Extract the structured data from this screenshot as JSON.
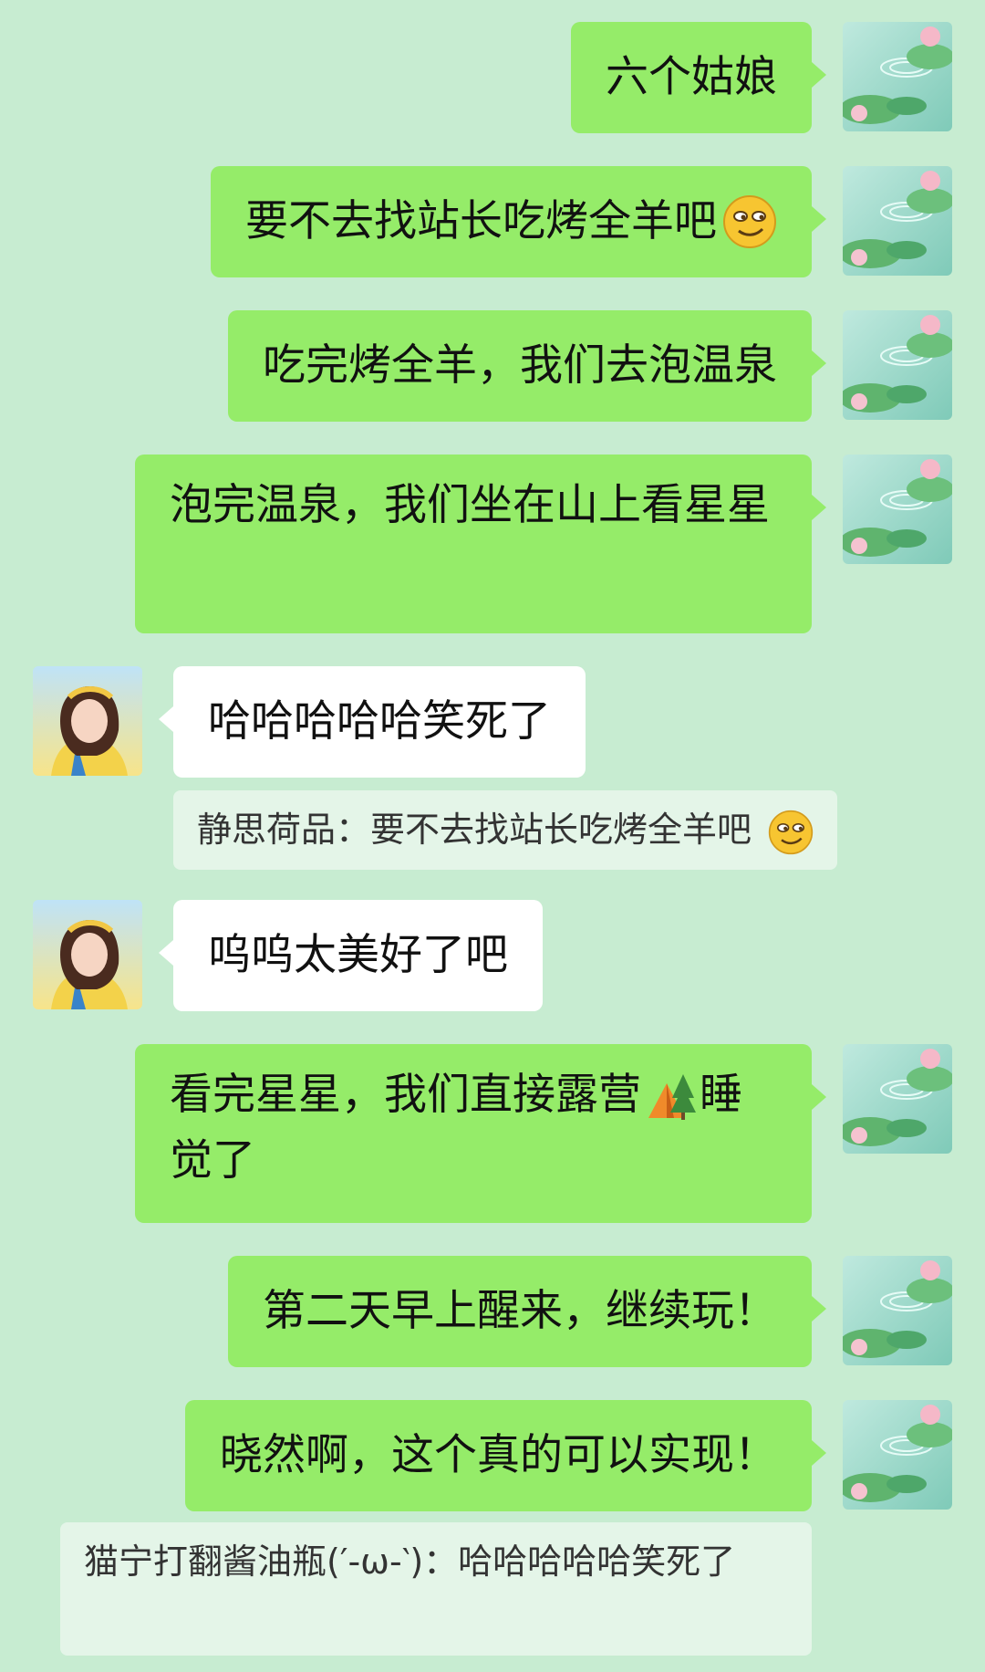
{
  "messages": [
    {
      "from": "me",
      "text": "六个姑娘"
    },
    {
      "from": "me",
      "text": "要不去找站长吃烤全羊吧",
      "emoji": "smirk-emoji"
    },
    {
      "from": "me",
      "text": "吃完烤全羊，我们去泡温泉"
    },
    {
      "from": "me",
      "text": "泡完温泉，我们坐在山上看星星"
    },
    {
      "from": "other",
      "text": "哈哈哈哈哈笑死了"
    },
    {
      "type": "quote",
      "text": "静思荷品：要不去找站长吃烤全羊吧",
      "emoji": "smirk-emoji"
    },
    {
      "from": "other",
      "text": "呜呜太美好了吧"
    },
    {
      "from": "me",
      "text_a": "看完星星，我们直接露营",
      "emoji": "tent-emoji",
      "text_b": "睡觉了"
    },
    {
      "from": "me",
      "text": "第二天早上醒来，继续玩！"
    },
    {
      "from": "me",
      "text": "晓然啊，这个真的可以实现！"
    },
    {
      "type": "quote",
      "text": "猫宁打翻酱油瓶(′-ω-‵)：哈哈哈哈哈笑死了"
    }
  ],
  "colors": {
    "background": "#c7ecd1",
    "my_bubble": "#95ec69",
    "other_bubble": "#ffffff",
    "quote_bg": "#e4f5e8"
  }
}
